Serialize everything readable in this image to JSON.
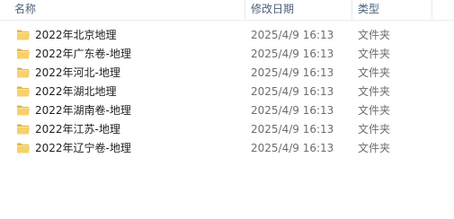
{
  "columns": {
    "name": "名称",
    "date": "修改日期",
    "type": "类型"
  },
  "icon": "folder-icon",
  "colors": {
    "folder_front": "#f7d16a",
    "folder_back": "#e2b445",
    "header_text": "#4c607a"
  },
  "rows": [
    {
      "name": "2022年北京地理",
      "date": "2025/4/9 16:13",
      "type": "文件夹"
    },
    {
      "name": "2022年广东卷-地理",
      "date": "2025/4/9 16:13",
      "type": "文件夹"
    },
    {
      "name": "2022年河北-地理",
      "date": "2025/4/9 16:13",
      "type": "文件夹"
    },
    {
      "name": "2022年湖北地理",
      "date": "2025/4/9 16:13",
      "type": "文件夹"
    },
    {
      "name": "2022年湖南卷-地理",
      "date": "2025/4/9 16:13",
      "type": "文件夹"
    },
    {
      "name": "2022年江苏-地理",
      "date": "2025/4/9 16:13",
      "type": "文件夹"
    },
    {
      "name": "2022年辽宁卷-地理",
      "date": "2025/4/9 16:13",
      "type": "文件夹"
    }
  ]
}
